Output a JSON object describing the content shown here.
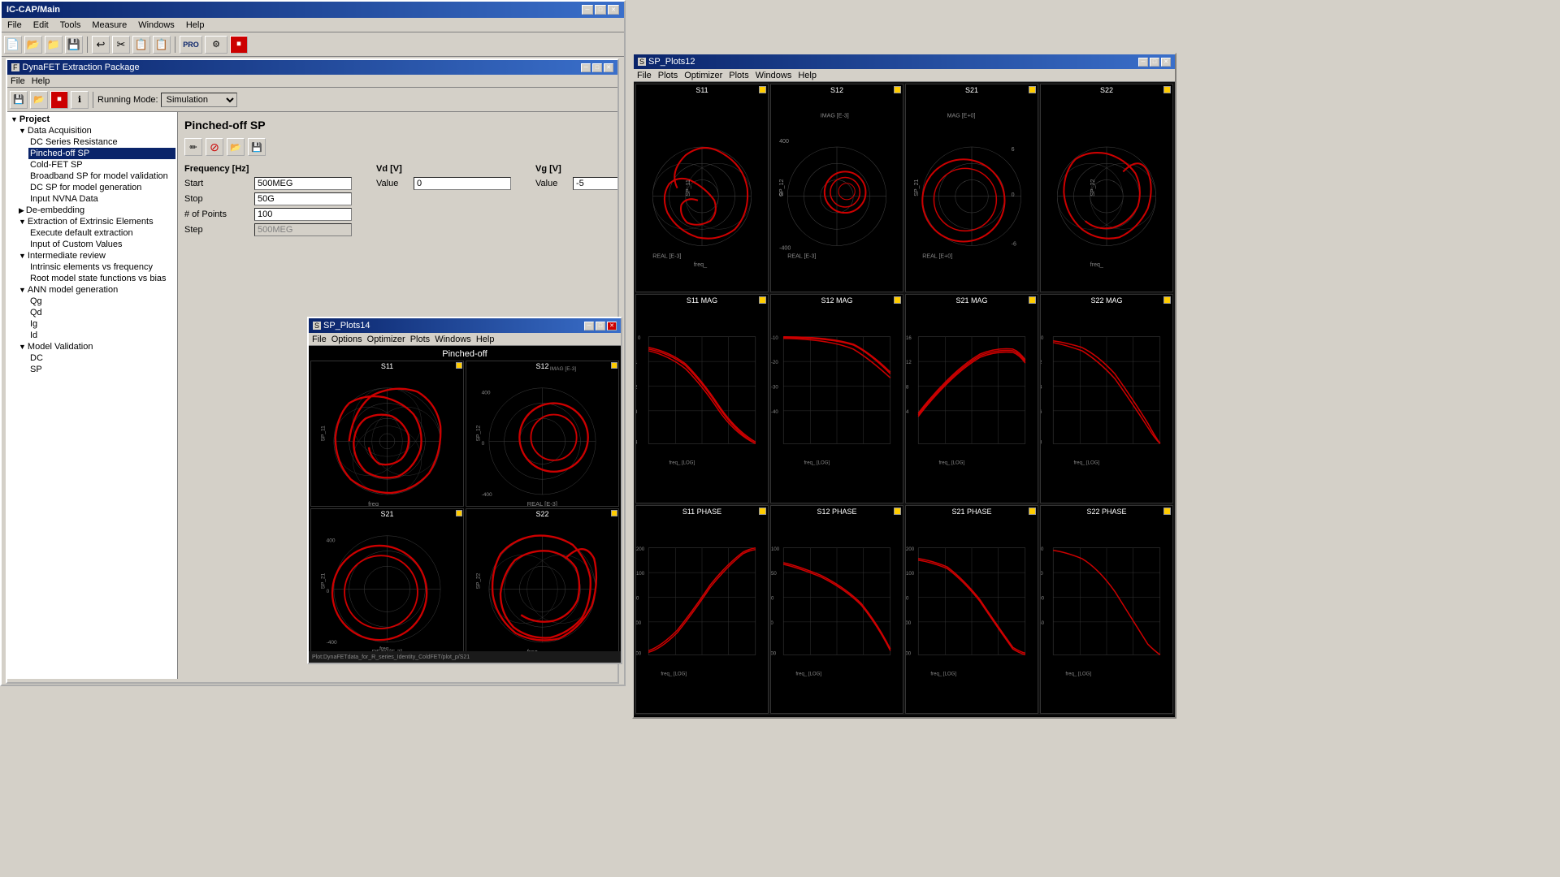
{
  "main_window": {
    "title": "IC-CAP/Main",
    "menus": [
      "File",
      "Edit",
      "Tools",
      "Measure",
      "Windows",
      "Help"
    ]
  },
  "dynafet_window": {
    "title": "DynaFET Extraction Package",
    "menus": [
      "File",
      "Help"
    ],
    "running_mode_label": "Running Mode:",
    "running_mode_value": "Simulation"
  },
  "project_tree": {
    "header": "Project",
    "items": [
      {
        "label": "Data Acquisition",
        "level": 1,
        "expanded": true
      },
      {
        "label": "DC Series Resistance",
        "level": 2
      },
      {
        "label": "Pinched-off SP",
        "level": 2,
        "selected": true
      },
      {
        "label": "Cold-FET SP",
        "level": 2
      },
      {
        "label": "Broadband SP for model validation",
        "level": 2
      },
      {
        "label": "DC SP for model generation",
        "level": 2
      },
      {
        "label": "Input NVNA Data",
        "level": 2
      },
      {
        "label": "De-embedding",
        "level": 1
      },
      {
        "label": "Extraction of Extrinsic Elements",
        "level": 1,
        "expanded": true
      },
      {
        "label": "Execute default extraction",
        "level": 2
      },
      {
        "label": "Input of Custom Values",
        "level": 2
      },
      {
        "label": "Intermediate review",
        "level": 1,
        "expanded": true
      },
      {
        "label": "Intrinsic elements vs frequency",
        "level": 2
      },
      {
        "label": "Root model state functions vs bias",
        "level": 2
      },
      {
        "label": "ANN model generation",
        "level": 1,
        "expanded": true
      },
      {
        "label": "Qg",
        "level": 2
      },
      {
        "label": "Qd",
        "level": 2
      },
      {
        "label": "Ig",
        "level": 2
      },
      {
        "label": "Id",
        "level": 2
      },
      {
        "label": "Model Validation",
        "level": 1,
        "expanded": true
      },
      {
        "label": "DC",
        "level": 2
      },
      {
        "label": "SP",
        "level": 2
      }
    ]
  },
  "content_panel": {
    "title": "Pinched-off SP",
    "frequency_label": "Frequency [Hz]",
    "vd_label": "Vd [V]",
    "vg_label": "Vg [V]",
    "start_label": "Start",
    "start_value": "500MEG",
    "stop_label": "Stop",
    "stop_value": "50G",
    "points_label": "# of Points",
    "points_value": "100",
    "step_label": "Step",
    "step_value": "500MEG",
    "vd_value_label": "Value",
    "vd_value": "0",
    "vg_value_label": "Value",
    "vg_value": "-5"
  },
  "sp_plots12": {
    "title": "SP_Plots12",
    "menus": [
      "File",
      "Plots",
      "Optimizer",
      "Plots",
      "Windows",
      "Help"
    ],
    "plots": [
      {
        "title": "S11",
        "row": 0,
        "col": 0,
        "type": "smith"
      },
      {
        "title": "S12",
        "row": 0,
        "col": 1,
        "type": "polar"
      },
      {
        "title": "S21",
        "row": 0,
        "col": 2,
        "type": "polar"
      },
      {
        "title": "S22",
        "row": 0,
        "col": 3,
        "type": "smith"
      },
      {
        "title": "S11 MAG",
        "row": 1,
        "col": 0,
        "type": "mag"
      },
      {
        "title": "S12 MAG",
        "row": 1,
        "col": 1,
        "type": "mag"
      },
      {
        "title": "S21 MAG",
        "row": 1,
        "col": 2,
        "type": "mag"
      },
      {
        "title": "S22 MAG",
        "row": 1,
        "col": 3,
        "type": "mag"
      },
      {
        "title": "S11 PHASE",
        "row": 2,
        "col": 0,
        "type": "phase"
      },
      {
        "title": "S12 PHASE",
        "row": 2,
        "col": 1,
        "type": "phase"
      },
      {
        "title": "S21 PHASE",
        "row": 2,
        "col": 2,
        "type": "phase"
      },
      {
        "title": "S22 PHASE",
        "row": 2,
        "col": 3,
        "type": "phase"
      }
    ]
  },
  "sp_plots14": {
    "title": "SP_Plots14",
    "menus": [
      "File",
      "Options",
      "Optimizer",
      "Plots",
      "Windows",
      "Help"
    ],
    "header": "Pinched-off",
    "plots": [
      {
        "title": "S11"
      },
      {
        "title": "S12"
      },
      {
        "title": "S21"
      },
      {
        "title": "S22"
      }
    ]
  },
  "icons": {
    "minimize": "─",
    "maximize": "□",
    "close": "✕",
    "new": "📄",
    "open": "📂",
    "save": "💾",
    "undo": "↩",
    "cut": "✂",
    "copy": "📋",
    "paste": "📋",
    "stop": "⏹",
    "run": "▶"
  }
}
